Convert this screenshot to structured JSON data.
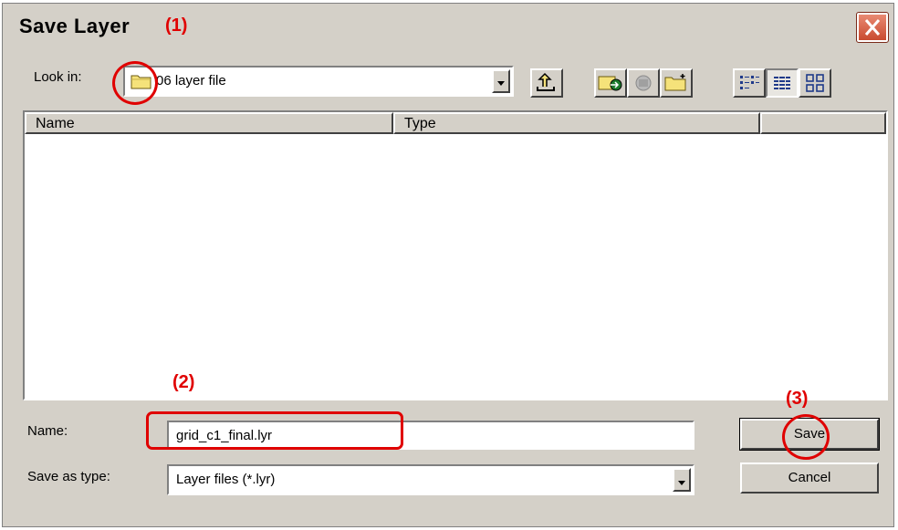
{
  "dialog": {
    "title": "Save Layer",
    "close_icon": "close-icon"
  },
  "look_in": {
    "label": "Look in:",
    "value": "06 layer file",
    "icon": "folder-icon"
  },
  "toolbar": {
    "icons": [
      "up-folder-icon",
      "connect-folder-icon",
      "disconnect-icon",
      "new-folder-icon",
      "list-view-icon",
      "details-view-icon",
      "thumbnails-view-icon"
    ]
  },
  "file_list": {
    "columns": [
      "Name",
      "Type",
      ""
    ]
  },
  "form": {
    "name_label": "Name:",
    "name_value": "grid_c1_final.lyr",
    "type_label": "Save as type:",
    "type_value": "Layer files (*.lyr)"
  },
  "buttons": {
    "save": "Save",
    "cancel": "Cancel"
  },
  "annotations": {
    "step1": "(1)",
    "step2": "(2)",
    "step3": "(3)",
    "color": "#e00000"
  }
}
